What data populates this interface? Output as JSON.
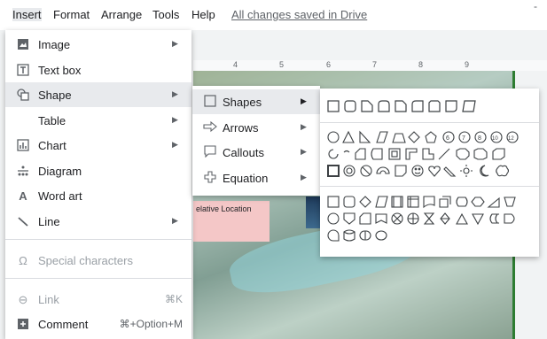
{
  "menubar": {
    "items": [
      "Insert",
      "Format",
      "Arrange",
      "Tools",
      "Help"
    ],
    "status": "All changes saved in Drive",
    "dash": "-"
  },
  "ruler": {
    "ticks": [
      "4",
      "5",
      "6",
      "7",
      "8",
      "9"
    ]
  },
  "slide": {
    "location_label": "elative Location"
  },
  "insert_menu": {
    "items": [
      {
        "label": "Image",
        "icon": "image-icon",
        "submenu": true
      },
      {
        "label": "Text box",
        "icon": "text-box-icon",
        "submenu": false
      },
      {
        "label": "Shape",
        "icon": "shape-icon",
        "submenu": true
      },
      {
        "label": "Table",
        "icon": "",
        "submenu": true
      },
      {
        "label": "Chart",
        "icon": "chart-icon",
        "submenu": true
      },
      {
        "label": "Diagram",
        "icon": "diagram-icon",
        "submenu": false
      },
      {
        "label": "Word art",
        "icon": "word-art-icon",
        "submenu": false
      },
      {
        "label": "Line",
        "icon": "line-icon",
        "submenu": true
      },
      {
        "label": "Special characters",
        "icon": "omega-icon",
        "submenu": false
      },
      {
        "label": "Link",
        "icon": "link-icon",
        "shortcut": "⌘K"
      },
      {
        "label": "Comment",
        "icon": "comment-icon",
        "shortcut": "⌘+Option+M"
      }
    ]
  },
  "shape_menu": {
    "items": [
      {
        "label": "Shapes",
        "icon": "square-icon"
      },
      {
        "label": "Arrows",
        "icon": "arrow-icon"
      },
      {
        "label": "Callouts",
        "icon": "callout-icon"
      },
      {
        "label": "Equation",
        "icon": "plus-icon"
      }
    ]
  },
  "colors": {
    "highlight": "#e8eaed",
    "slide_border": "#2e7d32",
    "location_box": "#f4c7c7"
  }
}
